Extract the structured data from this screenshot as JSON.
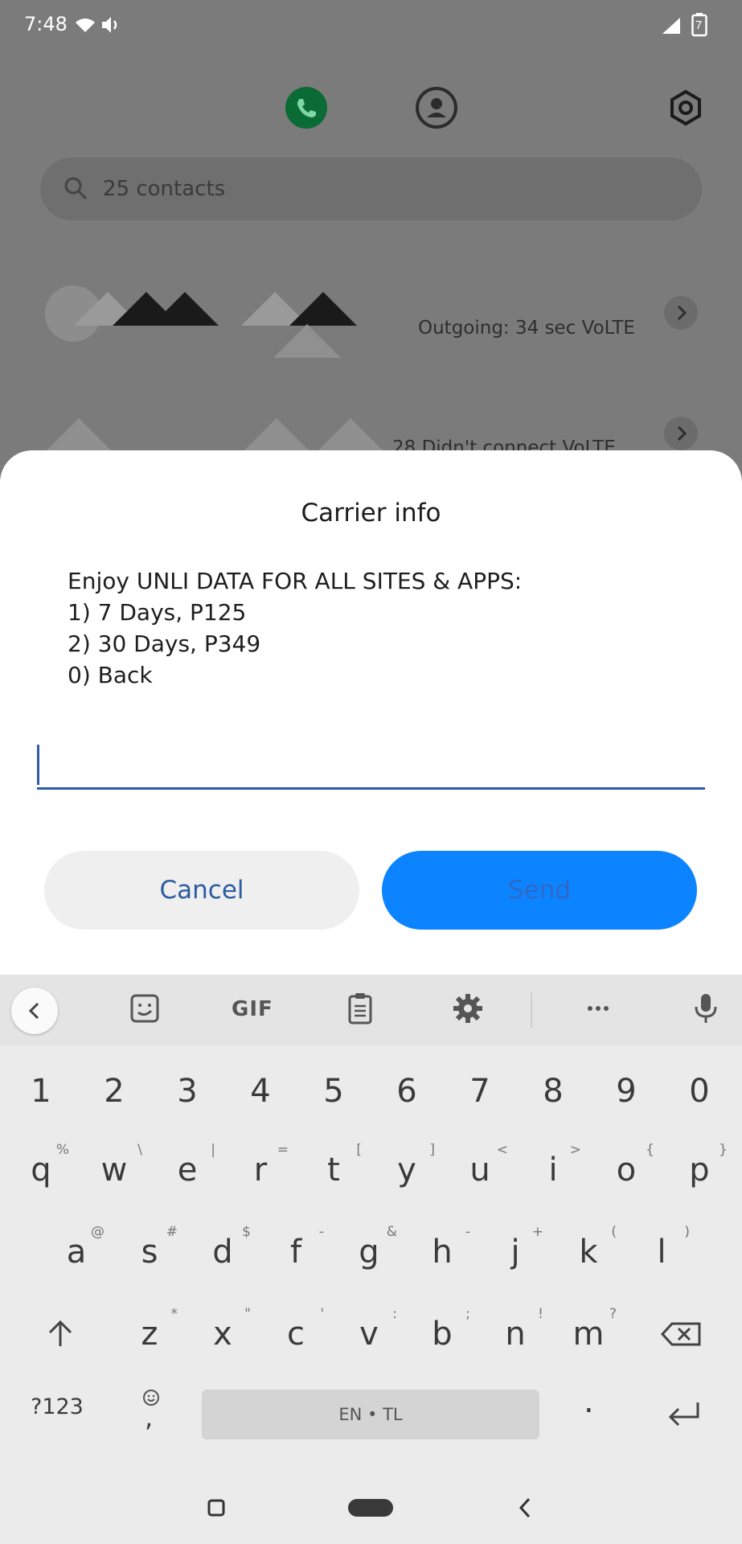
{
  "status_bar": {
    "time": "7:48",
    "sim_slot": "7"
  },
  "background_app": {
    "search_placeholder": "25 contacts",
    "calls": [
      {
        "detail": "Outgoing: 34 sec VoLTE"
      },
      {
        "detail": "28 Didn't connect VoLTE"
      }
    ]
  },
  "dialog": {
    "title": "Carrier info",
    "message_lines": [
      "Enjoy UNLI DATA FOR ALL SITES & APPS:",
      "1) 7 Days, P125",
      "2) 30 Days, P349",
      "0) Back"
    ],
    "input_value": "",
    "cancel_label": "Cancel",
    "send_label": "Send"
  },
  "keyboard": {
    "toolbar": {
      "gif_label": "GIF"
    },
    "number_row": [
      "1",
      "2",
      "3",
      "4",
      "5",
      "6",
      "7",
      "8",
      "9",
      "0"
    ],
    "row1": [
      {
        "key": "q",
        "hint": "%"
      },
      {
        "key": "w",
        "hint": "\\"
      },
      {
        "key": "e",
        "hint": "|"
      },
      {
        "key": "r",
        "hint": "="
      },
      {
        "key": "t",
        "hint": "["
      },
      {
        "key": "y",
        "hint": "]"
      },
      {
        "key": "u",
        "hint": "<"
      },
      {
        "key": "i",
        "hint": ">"
      },
      {
        "key": "o",
        "hint": "{"
      },
      {
        "key": "p",
        "hint": "}"
      }
    ],
    "row2": [
      {
        "key": "a",
        "hint": "@"
      },
      {
        "key": "s",
        "hint": "#"
      },
      {
        "key": "d",
        "hint": "$"
      },
      {
        "key": "f",
        "hint": "-"
      },
      {
        "key": "g",
        "hint": "&"
      },
      {
        "key": "h",
        "hint": "-"
      },
      {
        "key": "j",
        "hint": "+"
      },
      {
        "key": "k",
        "hint": "("
      },
      {
        "key": "l",
        "hint": ")"
      }
    ],
    "row3": [
      {
        "key": "z",
        "hint": "*"
      },
      {
        "key": "x",
        "hint": "\""
      },
      {
        "key": "c",
        "hint": "'"
      },
      {
        "key": "v",
        "hint": ":"
      },
      {
        "key": "b",
        "hint": ";"
      },
      {
        "key": "n",
        "hint": "!"
      },
      {
        "key": "m",
        "hint": "?"
      }
    ],
    "symbols_label": "?123",
    "comma_label": ",",
    "period_label": ".",
    "space_label": "EN • TL"
  },
  "colors": {
    "accent": "#0c84ff",
    "link": "#2e5ca8",
    "call_green": "#0a6b34"
  }
}
